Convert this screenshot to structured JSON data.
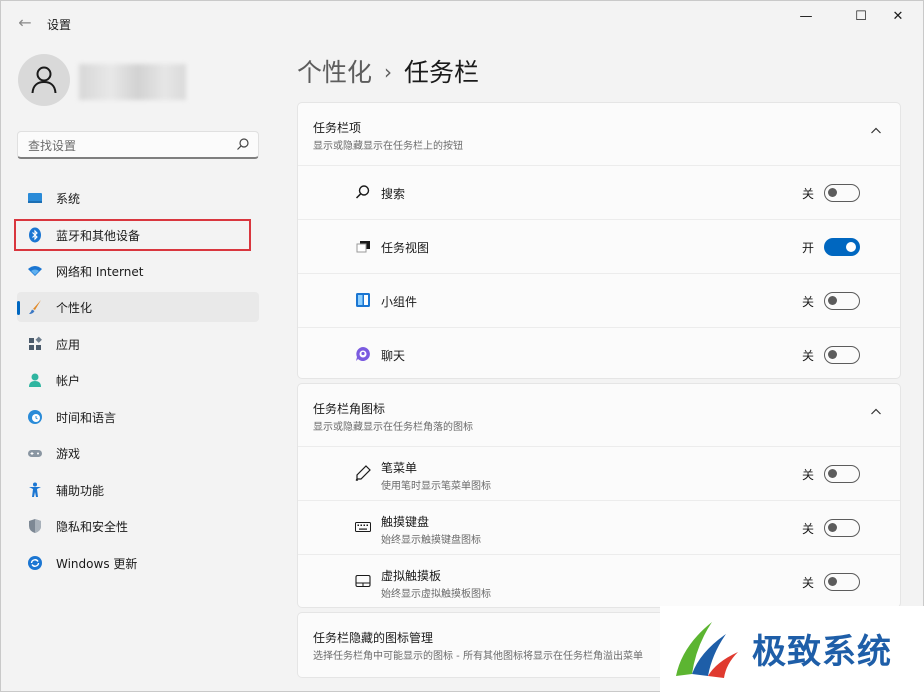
{
  "window": {
    "title": "设置",
    "back_glyph": "←",
    "minimize_glyph": "—",
    "maximize_glyph": "☐",
    "close_glyph": "✕"
  },
  "search": {
    "placeholder": "查找设置"
  },
  "nav": {
    "items": [
      {
        "label": "系统",
        "icon": "system-monitor-icon"
      },
      {
        "label": "蓝牙和其他设备",
        "icon": "bluetooth-icon"
      },
      {
        "label": "网络和 Internet",
        "icon": "wifi-icon"
      },
      {
        "label": "个性化",
        "icon": "brush-icon",
        "active": true
      },
      {
        "label": "应用",
        "icon": "apps-icon"
      },
      {
        "label": "帐户",
        "icon": "account-icon"
      },
      {
        "label": "时间和语言",
        "icon": "globe-clock-icon"
      },
      {
        "label": "游戏",
        "icon": "gamepad-icon"
      },
      {
        "label": "辅助功能",
        "icon": "accessibility-icon"
      },
      {
        "label": "隐私和安全性",
        "icon": "shield-icon"
      },
      {
        "label": "Windows 更新",
        "icon": "update-icon"
      }
    ]
  },
  "breadcrumb": {
    "parent": "个性化",
    "separator": "›",
    "current": "任务栏"
  },
  "sections": [
    {
      "title": "任务栏项",
      "subtitle": "显示或隐藏显示在任务栏上的按钮",
      "items": [
        {
          "label": "搜索",
          "state": "关",
          "on": false,
          "icon": "search-icon"
        },
        {
          "label": "任务视图",
          "state": "开",
          "on": true,
          "icon": "task-view-icon"
        },
        {
          "label": "小组件",
          "state": "关",
          "on": false,
          "icon": "widgets-icon"
        },
        {
          "label": "聊天",
          "state": "关",
          "on": false,
          "icon": "chat-icon"
        }
      ]
    },
    {
      "title": "任务栏角图标",
      "subtitle": "显示或隐藏显示在任务栏角落的图标",
      "items": [
        {
          "label": "笔菜单",
          "sub": "使用笔时显示笔菜单图标",
          "state": "关",
          "on": false,
          "icon": "pen-icon"
        },
        {
          "label": "触摸键盘",
          "sub": "始终显示触摸键盘图标",
          "state": "关",
          "on": false,
          "icon": "keyboard-icon"
        },
        {
          "label": "虚拟触摸板",
          "sub": "始终显示虚拟触摸板图标",
          "state": "关",
          "on": false,
          "icon": "touchpad-icon"
        }
      ]
    },
    {
      "title": "任务栏隐藏的图标管理",
      "subtitle": "选择任务栏角中可能显示的图标 - 所有其他图标将显示在任务栏角溢出菜单"
    }
  ],
  "watermark": {
    "text": "极致系统"
  },
  "colors": {
    "accent": "#0067c0",
    "highlight_box": "#d9363e"
  }
}
